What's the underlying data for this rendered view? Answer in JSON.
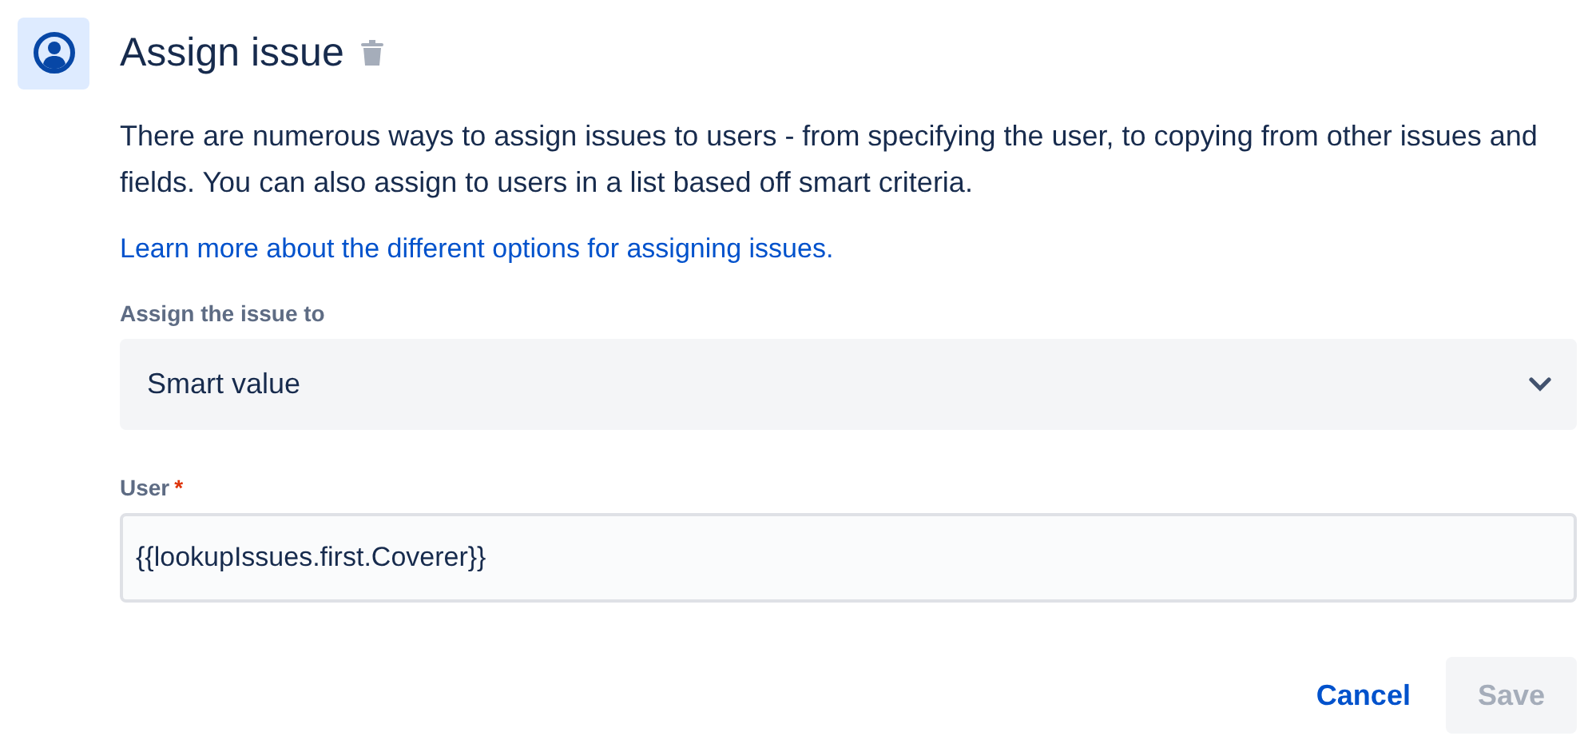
{
  "header": {
    "title": "Assign issue"
  },
  "description": "There are numerous ways to assign issues to users - from specifying the user, to copying from other issues and fields. You can also assign to users in a list based off smart criteria.",
  "link": "Learn more about the different options for assigning issues.",
  "assign_field": {
    "label": "Assign the issue to",
    "value": "Smart value"
  },
  "user_field": {
    "label": "User",
    "required_mark": "*",
    "value": "{{lookupIssues.first.Coverer}}"
  },
  "buttons": [
    {
      "label": "Cancel",
      "kind": "link",
      "disabled": false
    },
    {
      "label": "Save",
      "kind": "primary",
      "disabled": true
    }
  ]
}
